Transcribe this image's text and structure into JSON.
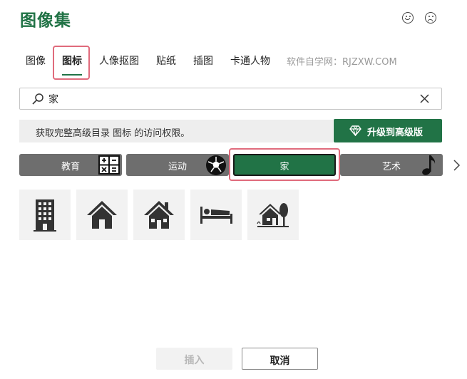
{
  "header": {
    "title": "图像集"
  },
  "tabs": [
    {
      "label": "图像"
    },
    {
      "label": "图标"
    },
    {
      "label": "人像抠图"
    },
    {
      "label": "贴纸"
    },
    {
      "label": "插图"
    },
    {
      "label": "卡通人物"
    }
  ],
  "active_tab": "图标",
  "watermark": "软件自学网：RJZXW.COM",
  "search": {
    "value": "家"
  },
  "banner": {
    "text": "获取完整高级目录 图标 的访问权限。",
    "upgrade_label": "升级到高级版"
  },
  "categories": [
    {
      "label": "教育",
      "icon": "calculator-icon"
    },
    {
      "label": "运动",
      "icon": "soccer-ball-icon"
    },
    {
      "label": "家",
      "icon": "",
      "selected": true
    },
    {
      "label": "艺术",
      "icon": "music-note-icon"
    }
  ],
  "results": [
    {
      "icon": "apartment-building-icon"
    },
    {
      "icon": "house-icon"
    },
    {
      "icon": "house-with-chimney-icon"
    },
    {
      "icon": "bed-icon"
    },
    {
      "icon": "house-with-tree-icon"
    }
  ],
  "footer": {
    "insert_label": "插入",
    "cancel_label": "取消"
  },
  "colors": {
    "accent": "#217346",
    "highlight": "#e06b7c",
    "category_bg": "#6e6e6e"
  }
}
